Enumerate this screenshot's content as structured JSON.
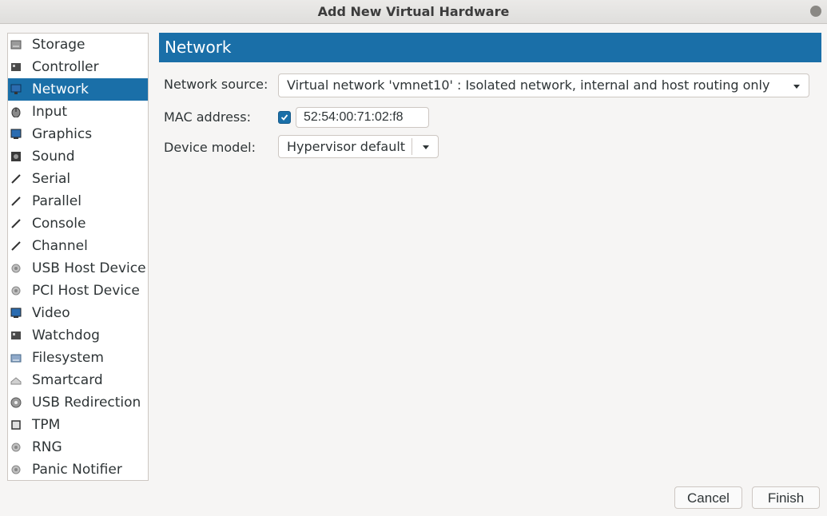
{
  "window": {
    "title": "Add New Virtual Hardware"
  },
  "sidebar": {
    "items": [
      {
        "label": "Storage",
        "icon": "storage-icon"
      },
      {
        "label": "Controller",
        "icon": "controller-icon"
      },
      {
        "label": "Network",
        "icon": "network-icon",
        "selected": true
      },
      {
        "label": "Input",
        "icon": "input-icon"
      },
      {
        "label": "Graphics",
        "icon": "graphics-icon"
      },
      {
        "label": "Sound",
        "icon": "sound-icon"
      },
      {
        "label": "Serial",
        "icon": "serial-icon"
      },
      {
        "label": "Parallel",
        "icon": "parallel-icon"
      },
      {
        "label": "Console",
        "icon": "console-icon"
      },
      {
        "label": "Channel",
        "icon": "channel-icon"
      },
      {
        "label": "USB Host Device",
        "icon": "usb-host-device-icon"
      },
      {
        "label": "PCI Host Device",
        "icon": "pci-host-device-icon"
      },
      {
        "label": "Video",
        "icon": "video-icon"
      },
      {
        "label": "Watchdog",
        "icon": "watchdog-icon"
      },
      {
        "label": "Filesystem",
        "icon": "filesystem-icon"
      },
      {
        "label": "Smartcard",
        "icon": "smartcard-icon"
      },
      {
        "label": "USB Redirection",
        "icon": "usb-redirection-icon"
      },
      {
        "label": "TPM",
        "icon": "tpm-icon"
      },
      {
        "label": "RNG",
        "icon": "rng-icon"
      },
      {
        "label": "Panic Notifier",
        "icon": "panic-notifier-icon"
      }
    ]
  },
  "main": {
    "section_title": "Network",
    "network_source": {
      "label": "Network source:",
      "value": "Virtual network 'vmnet10' : Isolated network, internal and host routing only"
    },
    "mac_address": {
      "label": "MAC address:",
      "checked": true,
      "value": "52:54:00:71:02:f8"
    },
    "device_model": {
      "label": "Device model:",
      "value": "Hypervisor default"
    }
  },
  "footer": {
    "cancel_label": "Cancel",
    "finish_label": "Finish"
  },
  "colors": {
    "accent": "#1a6fa8",
    "background": "#f6f5f4",
    "border": "#cdc7c2"
  }
}
